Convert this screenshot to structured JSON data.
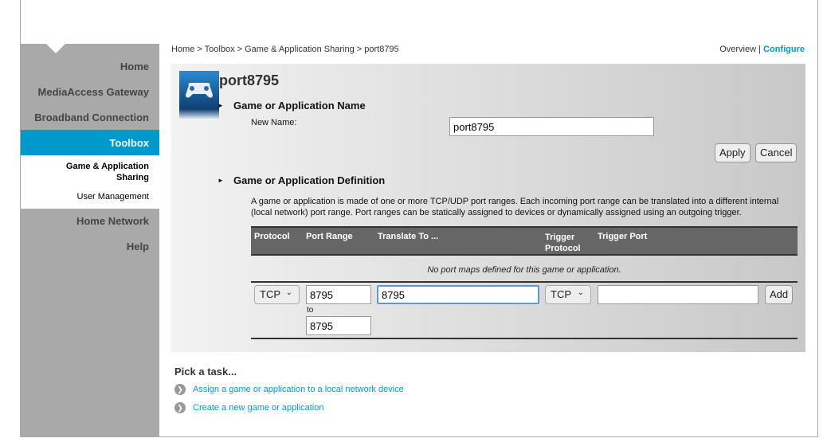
{
  "sidebar": {
    "items": [
      "Home",
      "MediaAccess Gateway",
      "Broadband Connection",
      "Toolbox",
      "Home Network",
      "Help"
    ],
    "sub_items": [
      "Game & Application Sharing",
      "User Management"
    ]
  },
  "breadcrumb": "Home > Toolbox > Game & Application Sharing > port8795",
  "top_links": {
    "overview": "Overview",
    "sep": "|",
    "configure": "Configure"
  },
  "title": "port8795",
  "name_section": {
    "heading": "Game or Application Name",
    "label": "New Name:",
    "value": "port8795",
    "apply": "Apply",
    "cancel": "Cancel"
  },
  "def_section": {
    "heading": "Game or Application Definition",
    "description": "A game or application is made of one or more TCP/UDP port ranges. Each incoming port range can be translated into a different internal (local network) port range. Port ranges can be statically assigned to devices or dynamically assigned using an outgoing trigger.",
    "columns": [
      "Protocol",
      "Port Range",
      "Translate To ...",
      "Trigger Protocol",
      "Trigger Port"
    ],
    "empty_text": "No port maps defined for this game or application.",
    "row": {
      "protocol": "TCP",
      "port_from": "8795",
      "to_label": "to",
      "port_to": "8795",
      "translate": "8795",
      "trigger_protocol": "TCP",
      "trigger_port": "",
      "add": "Add"
    }
  },
  "tasks": {
    "heading": "Pick a task...",
    "items": [
      "Assign a game or application to a local network device",
      "Create a new game or application"
    ]
  },
  "colors": {
    "accent": "#0099cc",
    "sidebar": "#a9a9a9"
  }
}
